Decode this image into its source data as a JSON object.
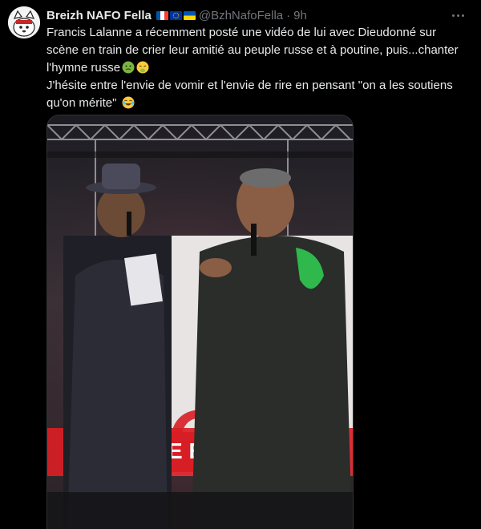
{
  "tweet": {
    "author": {
      "display_name": "Breizh NAFO Fella",
      "flags": [
        "france-flag-icon",
        "eu-flag-icon",
        "ukraine-flag-icon"
      ],
      "handle": "@BzhNafoFella",
      "separator": "·",
      "time": "9h"
    },
    "text": {
      "para1_part1": "Francis Lalanne a récemment posté une vidéo de lui avec Dieudonné sur scène en train de crier leur amitié au peuple russe et à poutine, puis...chanter l'hymne russe",
      "para1_emojis": [
        "nauseated-face-icon",
        "vomiting-face-icon"
      ],
      "para2": "J'hésite entre l'envie de vomir et l'envie de rire en pensant \"on a les soutiens qu'on mérite\"",
      "para2_emoji": "tears-of-joy-icon"
    },
    "media": {
      "sign_text": "E ÉDI",
      "accent_red": "#d81e25"
    }
  },
  "colors": {
    "background": "#000000",
    "text": "#e7e9ea",
    "muted": "#71767b"
  }
}
